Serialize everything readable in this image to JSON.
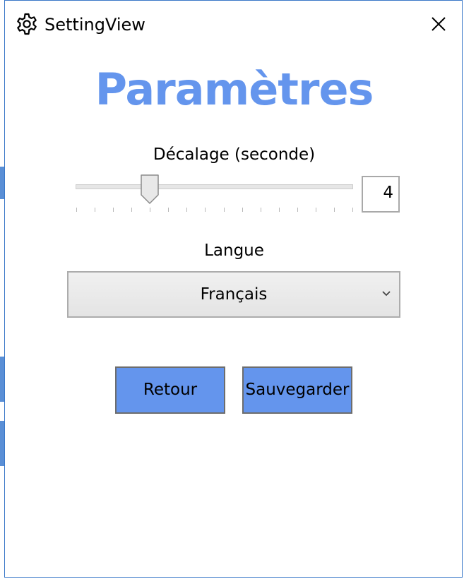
{
  "window": {
    "title": "SettingView"
  },
  "main": {
    "heading": "Paramètres",
    "offset": {
      "label": "Décalage (seconde)",
      "value": "4",
      "min": 0,
      "max": 15,
      "current": 4
    },
    "language": {
      "label": "Langue",
      "selected": "Français"
    },
    "buttons": {
      "back": "Retour",
      "save": "Sauvegarder"
    }
  },
  "icons": {
    "title": "gear-icon",
    "close": "close-icon",
    "dropdown": "chevron-down-icon"
  },
  "colors": {
    "accent": "#6495ed",
    "window_border": "#3a78c8"
  }
}
